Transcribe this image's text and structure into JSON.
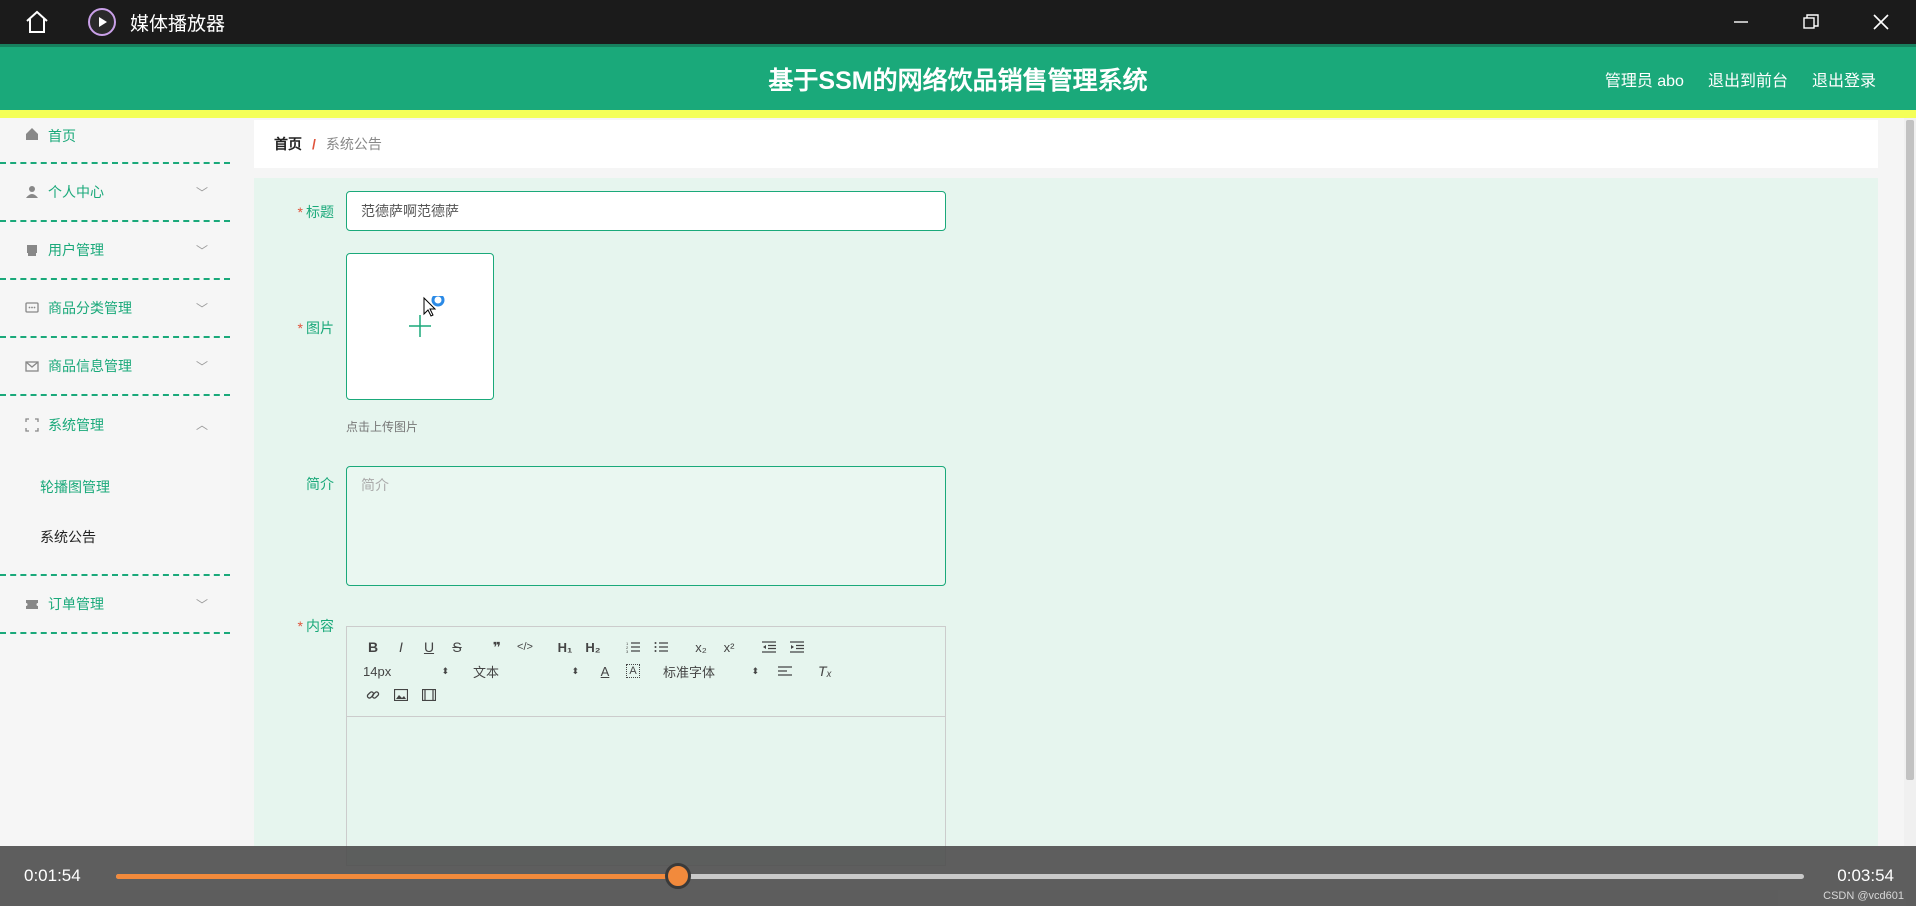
{
  "player": {
    "title": "媒体播放器",
    "current_time": "0:01:54",
    "total_time": "0:03:54",
    "progress": 0.333,
    "watermark": "CSDN @vcd601"
  },
  "header": {
    "title": "基于SSM的网络饮品销售管理系统",
    "admin_label": "管理员 abo",
    "back_front": "退出到前台",
    "logout": "退出登录"
  },
  "sidebar": {
    "items": [
      {
        "label": "首页",
        "icon": "home-icon"
      },
      {
        "label": "个人中心",
        "icon": "user-icon"
      },
      {
        "label": "用户管理",
        "icon": "users-icon"
      },
      {
        "label": "商品分类管理",
        "icon": "chat-icon"
      },
      {
        "label": "商品信息管理",
        "icon": "mail-icon"
      },
      {
        "label": "系统管理",
        "icon": "frame-icon"
      },
      {
        "label": "订单管理",
        "icon": "ticket-icon"
      }
    ],
    "sub_items": [
      {
        "label": "轮播图管理"
      },
      {
        "label": "系统公告"
      }
    ]
  },
  "breadcrumb": {
    "home": "首页",
    "separator": "/",
    "current": "系统公告"
  },
  "form": {
    "title_label": "标题",
    "title_value": "范德萨啊范德萨",
    "image_label": "图片",
    "upload_hint": "点击上传图片",
    "intro_label": "简介",
    "intro_placeholder": "简介",
    "content_label": "内容",
    "required_mark": "*"
  },
  "editor": {
    "font_size": "14px",
    "paragraph": "文本",
    "font_family": "标准字体"
  },
  "colors": {
    "accent": "#1aa97a",
    "highlight": "#f4ff57",
    "progress": "#f28a3c"
  }
}
